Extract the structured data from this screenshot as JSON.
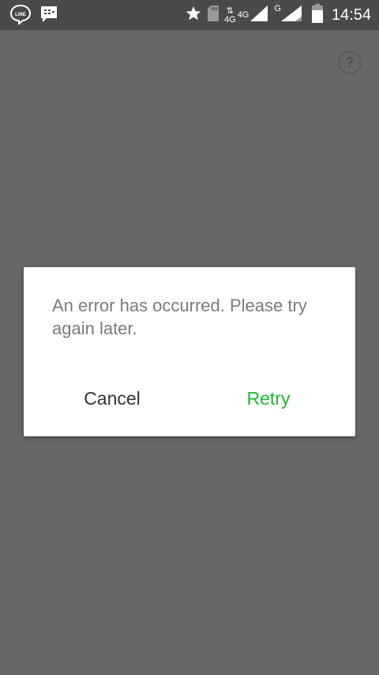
{
  "status_bar": {
    "time": "14:54",
    "network_primary": "4G",
    "network_primary_sub": "4G",
    "network_secondary": "G",
    "icons": [
      "line-icon",
      "bbm-icon",
      "star-icon",
      "sd-card-icon",
      "data-arrows-icon",
      "signal-icon",
      "signal-icon",
      "battery-icon"
    ]
  },
  "help": {
    "label": "?"
  },
  "dialog": {
    "message": "An error has occurred. Please try again later.",
    "cancel_label": "Cancel",
    "retry_label": "Retry",
    "retry_color": "#1db82e"
  }
}
